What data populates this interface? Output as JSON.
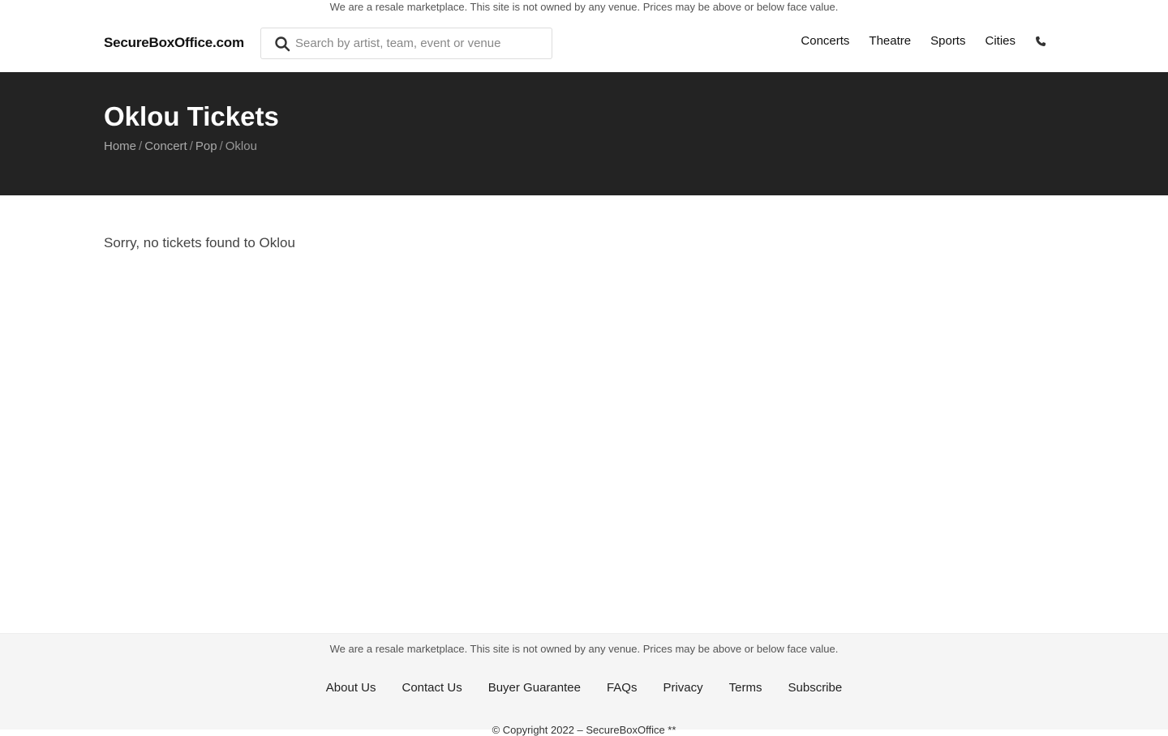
{
  "disclaimer": "We are a resale marketplace. This site is not owned by any venue. Prices may be above or below face value.",
  "header": {
    "logo": "SecureBoxOffice.com",
    "search": {
      "placeholder": "Search by artist, team, event or venue",
      "value": ""
    },
    "nav": [
      "Concerts",
      "Theatre",
      "Sports",
      "Cities"
    ],
    "phone_icon": "phone-icon"
  },
  "hero": {
    "title": "Oklou Tickets",
    "breadcrumb": [
      "Home",
      "Concert",
      "Pop",
      "Oklou"
    ],
    "background_color": "#232323"
  },
  "main": {
    "message": "Sorry, no tickets found to Oklou"
  },
  "footer": {
    "disclaimer": "We are a resale marketplace. This site is not owned by any venue. Prices may be above or below face value.",
    "links": [
      "About Us",
      "Contact Us",
      "Buyer Guarantee",
      "FAQs",
      "Privacy",
      "Terms",
      "Subscribe"
    ],
    "copyright": "© Copyright 2022 – SecureBoxOffice **"
  }
}
